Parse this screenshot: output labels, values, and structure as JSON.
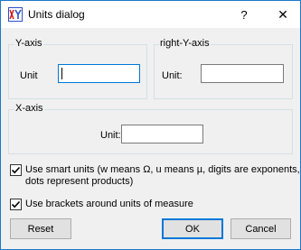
{
  "window": {
    "title": "Units dialog",
    "help_glyph": "?",
    "close_glyph": "✕"
  },
  "groups": {
    "y_axis": {
      "title": "Y-axis",
      "unit_label": "Unit",
      "value": ""
    },
    "right_y_axis": {
      "title": "right-Y-axis",
      "unit_label": "Unit:",
      "value": ""
    },
    "x_axis": {
      "title": "X-axis",
      "unit_label": "Unit:",
      "value": ""
    }
  },
  "options": {
    "smart_units": {
      "label_line1": "Use smart units (w means Ω, u means µ, digits are exponents,",
      "label_line2": "dots represent products)",
      "checked": true
    },
    "brackets": {
      "label": "Use brackets around units of measure",
      "checked": true
    }
  },
  "buttons": {
    "reset": "Reset",
    "ok": "OK",
    "cancel": "Cancel"
  },
  "colors": {
    "window_border": "#1979ca",
    "focus": "#0078d7",
    "icon_red": "#cc1f1f",
    "icon_blue": "#2a4fc7"
  }
}
